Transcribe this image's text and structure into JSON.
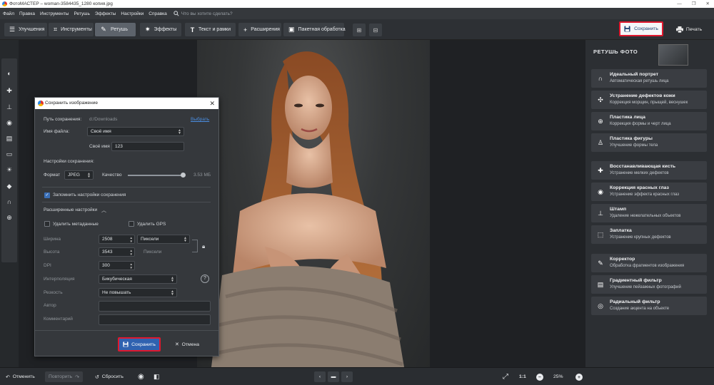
{
  "window": {
    "title": "ФотоМАСТЕР – woman-3584435_1280 копия.jpg",
    "controls": [
      "—",
      "❐",
      "✕"
    ]
  },
  "menu": {
    "items": [
      "Файл",
      "Правка",
      "Инструменты",
      "Ретушь",
      "Эффекты",
      "Настройки",
      "Справка"
    ],
    "search_placeholder": "Что вы хотите сделать?"
  },
  "toolbar": {
    "tabs": [
      {
        "label": "Улучшения",
        "icon": "sliders-icon"
      },
      {
        "label": "Инструменты",
        "icon": "crop-icon"
      },
      {
        "label": "Ретушь",
        "icon": "brush-icon",
        "active": true
      },
      {
        "label": "Эффекты",
        "icon": "sparkle-icon"
      },
      {
        "label": "Текст и рамки",
        "icon": "text-icon"
      },
      {
        "label": "Расширения",
        "icon": "plus-icon"
      },
      {
        "label": "Пакетная обработка",
        "icon": "batch-icon"
      }
    ],
    "save_label": "Сохранить",
    "print_label": "Печать"
  },
  "right_panel": {
    "title": "РЕТУШЬ ФОТО",
    "items": [
      {
        "title": "Идеальный портрет",
        "subtitle": "Автоматическая ретушь лица",
        "icon": "portrait-icon"
      },
      {
        "title": "Устранение дефектов кожи",
        "subtitle": "Коррекция морщин, прыщей, веснушек",
        "icon": "skin-icon"
      },
      {
        "title": "Пластика лица",
        "subtitle": "Коррекция формы и черт лица",
        "icon": "face-icon"
      },
      {
        "title": "Пластика фигуры",
        "subtitle": "Улучшение формы тела",
        "icon": "figure-icon"
      },
      {
        "title": "Восстанавливающая кисть",
        "subtitle": "Устранение мелких дефектов",
        "icon": "healing-brush-icon"
      },
      {
        "title": "Коррекция красных глаз",
        "subtitle": "Устранение эффекта красных глаз",
        "icon": "eye-icon"
      },
      {
        "title": "Штамп",
        "subtitle": "Удаление нежелательных объектов",
        "icon": "stamp-icon"
      },
      {
        "title": "Заплатка",
        "subtitle": "Устранение крупных дефектов",
        "icon": "patch-icon"
      },
      {
        "title": "Корректор",
        "subtitle": "Обработка фрагментов изображения",
        "icon": "corrector-icon"
      },
      {
        "title": "Градиентный фильтр",
        "subtitle": "Улучшение пейзажных фотографий",
        "icon": "gradient-filter-icon"
      },
      {
        "title": "Радиальный фильтр",
        "subtitle": "Создание акцента на объекте",
        "icon": "radial-filter-icon"
      }
    ]
  },
  "left_tools": [
    "portrait-icon",
    "healing-brush-icon",
    "stamp-icon",
    "corrector-icon",
    "gradient-filter-icon",
    "radial-filter-icon",
    "sun-icon",
    "fill-icon",
    "magnet-icon",
    "face-icon"
  ],
  "dialog": {
    "title": "Сохранить изображение",
    "path_label": "Путь сохранения:",
    "path_value": "d:/Downloads",
    "choose_link": "Выбрать",
    "filename_label": "Имя файла:",
    "filename_option": "Своё имя",
    "own_name_label": "Своё имя",
    "own_name_value": "123",
    "save_settings_label": "Настройки сохранения:",
    "format_label": "Формат",
    "format_value": "JPEG",
    "quality_label": "Качество",
    "quality_fraction": 1.0,
    "file_size": "3.53 МБ",
    "remember_label": "Запомнить настройки сохранения",
    "remember_checked": true,
    "advanced_label": "Расширенные настройки",
    "remove_metadata_label": "Удалить метаданные",
    "remove_metadata_checked": false,
    "remove_gps_label": "Удалить GPS",
    "remove_gps_checked": false,
    "width_label": "Ширина",
    "width_value": "2508",
    "unit_value": "Пиксели",
    "height_label": "Высота",
    "height_value": "3543",
    "height_unit": "Пиксели",
    "dpi_label": "DPI",
    "dpi_value": "300",
    "interp_label": "Интерполяция",
    "interp_value": "Бикубическая",
    "sharp_label": "Резкость",
    "sharp_value": "Не повышать",
    "author_label": "Автор",
    "author_value": "",
    "comment_label": "Комментарий",
    "comment_value": "",
    "help_glyph": "?",
    "save_button": "Сохранить",
    "cancel_button": "Отмена"
  },
  "bottom": {
    "undo": "Отменить",
    "redo": "Повторить",
    "reset": "Сбросить",
    "ratio": "1:1",
    "zoom": "25%"
  }
}
